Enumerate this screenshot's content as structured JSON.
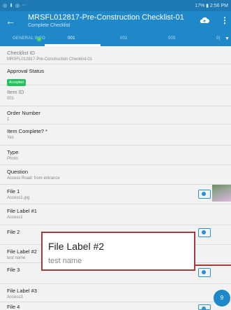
{
  "status_bar": {
    "left_icons": [
      "◎",
      "⬇",
      "◎",
      "···"
    ],
    "right_text": "17% ▮ 2:56 PM"
  },
  "app_bar": {
    "title": "MRSFL012817-Pre-Construction Checklist-01",
    "subtitle": "Complete Checklist",
    "back_icon": "←",
    "more_icon": "⋮"
  },
  "tabs": [
    {
      "label": "GENERAL INFO",
      "active": false
    },
    {
      "label": "001",
      "active": true
    },
    {
      "label": "002",
      "active": false
    },
    {
      "label": "005",
      "active": false
    },
    {
      "label": "0(",
      "active": false
    }
  ],
  "fields": [
    {
      "label": "Checklist ID",
      "value": "MRSFL012817-Pre-Construction Checklist-01"
    },
    {
      "label": "Approval Status",
      "badge": "Accepted"
    },
    {
      "label": "Item ID",
      "value": "001"
    },
    {
      "label": "Order Number",
      "value": "1"
    },
    {
      "label": "Item Complete? *",
      "value": "Yes"
    },
    {
      "label": "Type",
      "value": "Photo"
    },
    {
      "label": "Question",
      "value": "Access Road: from entrance"
    },
    {
      "label": "File 1",
      "value": "Access1.jpg"
    },
    {
      "label": "File Label #1",
      "value": "Access1"
    },
    {
      "label": "File 2",
      "value": ""
    },
    {
      "label": "File Label #2",
      "value": "test name"
    },
    {
      "label": "File 3",
      "value": ""
    },
    {
      "label": "File Label #3",
      "value": "Access3"
    },
    {
      "label": "File 4",
      "value": ""
    }
  ],
  "zoom_callout": {
    "label": "File Label #2",
    "value": "test name"
  },
  "fab_label": "9"
}
